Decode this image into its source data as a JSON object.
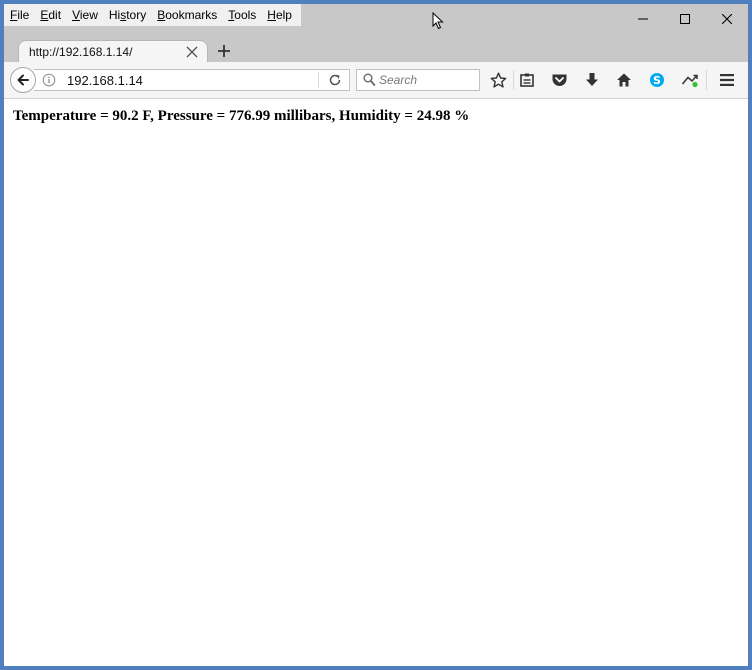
{
  "menu": {
    "file": {
      "key": "F",
      "rest": "ile"
    },
    "edit": {
      "key": "E",
      "rest": "dit"
    },
    "view": {
      "key": "V",
      "rest": "iew"
    },
    "history": {
      "pre": "Hi",
      "key": "s",
      "rest": "tory"
    },
    "bookmarks": {
      "key": "B",
      "rest": "ookmarks"
    },
    "tools": {
      "key": "T",
      "rest": "ools"
    },
    "help": {
      "key": "H",
      "rest": "elp"
    }
  },
  "tab": {
    "title": "http://192.168.1.14/"
  },
  "address": {
    "url": "192.168.1.14"
  },
  "search": {
    "placeholder": "Search"
  },
  "page": {
    "text": "Temperature = 90.2 F, Pressure = 776.99 millibars, Humidity = 24.98 %"
  },
  "colors": {
    "desktop_border": "#4f7fbd",
    "skype": "#00a9f0",
    "sync_dot": "#2fc52f"
  },
  "icons": [
    "back-arrow-icon",
    "info-icon",
    "reload-icon",
    "search-icon",
    "bookmark-star-icon",
    "reading-list-icon",
    "pocket-icon",
    "download-icon",
    "home-icon",
    "skype-icon",
    "sync-icon",
    "hamburger-menu-icon"
  ]
}
